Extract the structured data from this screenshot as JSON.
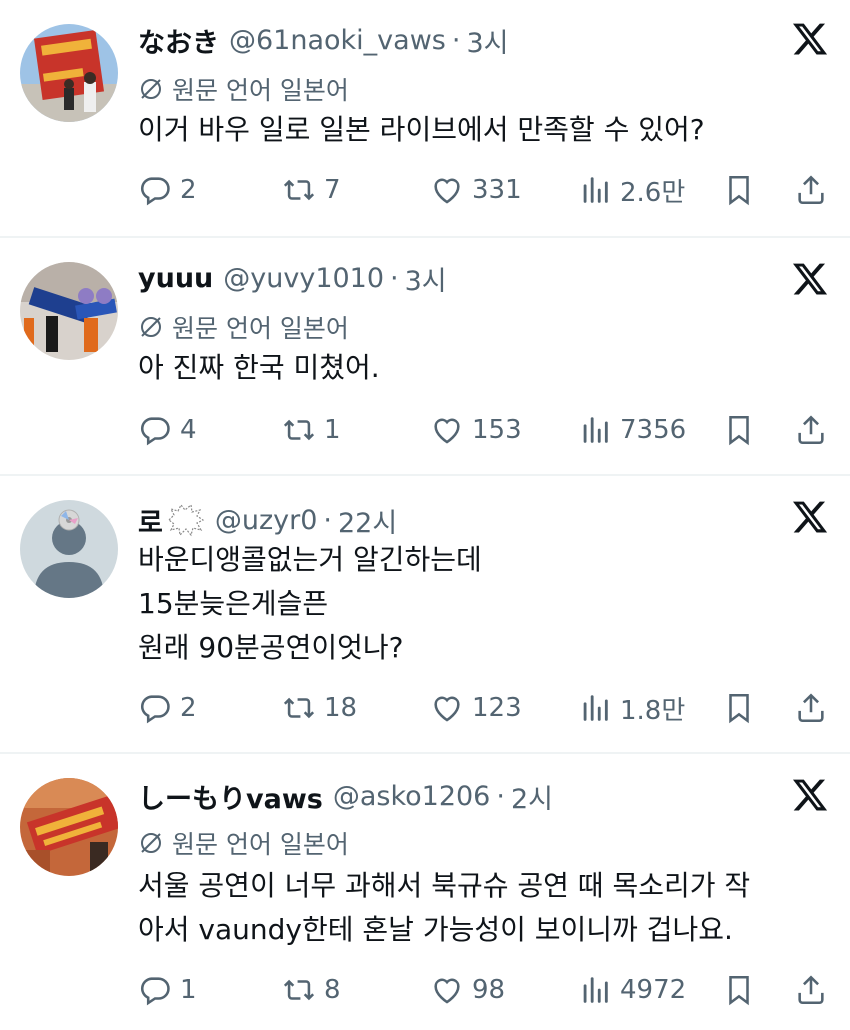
{
  "translation_note_prefix": "원문 언어",
  "posts": [
    {
      "display_name": "なおき",
      "handle": "@61naoki_vaws",
      "separator": "·",
      "time": "3시",
      "translation_note": "원문 언어 일본어",
      "text_lines": [
        "이거 바우 일로 일본 라이브에서 만족할 수 있어?"
      ],
      "replies": "2",
      "reposts": "7",
      "likes": "331",
      "views": "2.6만"
    },
    {
      "display_name": "yuuu",
      "handle": "@yuvy1010",
      "separator": "·",
      "time": "3시",
      "translation_note": "원문 언어 일본어",
      "text_lines": [
        "아 진짜 한국 미쳤어."
      ],
      "replies": "4",
      "reposts": "1",
      "likes": "153",
      "views": "7356"
    },
    {
      "display_name": "로",
      "handle": "@uzyr0",
      "separator": "·",
      "time": "22시",
      "translation_note": "",
      "text_lines": [
        "바운디앵콜없는거 알긴하는데",
        "15분늦은게슬픈",
        "원래 90분공연이엇나?"
      ],
      "replies": "2",
      "reposts": "18",
      "likes": "123",
      "views": "1.8만"
    },
    {
      "display_name": "しーもりvaws",
      "handle": "@asko1206",
      "separator": "·",
      "time": "2시",
      "translation_note": "원문 언어 일본어",
      "text_lines": [
        "서울 공연이 너무 과해서 북규슈 공연 때 목소리가 작",
        "아서 vaundy한테 혼날 가능성이 보이니까 겁나요."
      ],
      "replies": "1",
      "reposts": "8",
      "likes": "98",
      "views": "4972"
    }
  ],
  "icons": {
    "reply": "reply-icon",
    "repost": "repost-icon",
    "like": "heart-icon",
    "views": "views-icon",
    "bookmark": "bookmark-icon",
    "share": "share-icon",
    "brand": "x-logo-icon",
    "translate": "globe-slash-icon"
  },
  "colors": {
    "text_primary": "#0f1419",
    "text_secondary": "#536471",
    "divider": "#eff3f4",
    "background": "#ffffff"
  }
}
